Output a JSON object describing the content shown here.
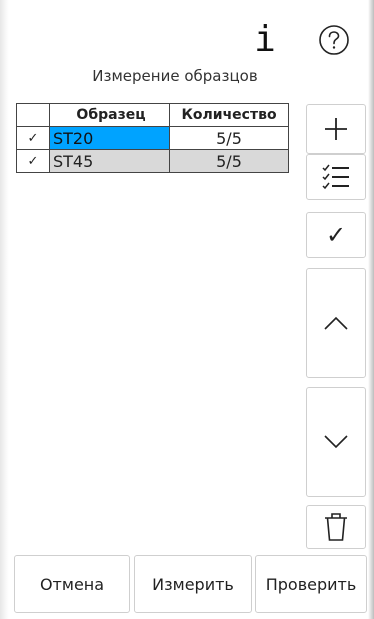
{
  "header": {
    "info_icon": "i",
    "title": "Измерение образцов"
  },
  "table": {
    "columns": [
      "",
      "Образец",
      "Количество"
    ],
    "rows": [
      {
        "check": "✓",
        "name": "ST20",
        "qty": "5/5",
        "selected": true
      },
      {
        "check": "✓",
        "name": "ST45",
        "qty": "5/5",
        "selected": false
      }
    ]
  },
  "side_toolbar": {
    "icons": [
      "plus-icon",
      "checklist-icon",
      "checkmark-icon",
      "chevron-up-icon",
      "chevron-down-icon",
      "trash-icon"
    ],
    "check_glyph": "✓"
  },
  "footer": {
    "cancel": "Отмена",
    "measure": "Измерить",
    "verify": "Проверить"
  },
  "colors": {
    "selection": "#00a3ff",
    "zebra_row": "#d9d9d9",
    "button_border": "#cfcfcf"
  }
}
